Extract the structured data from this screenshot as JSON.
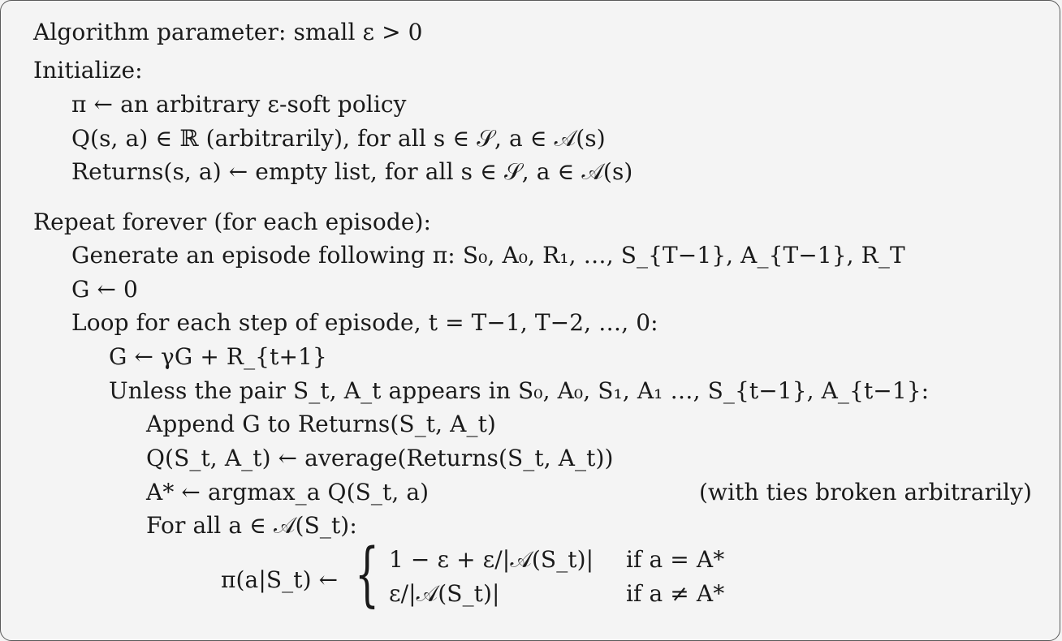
{
  "algorithm": {
    "param": "Algorithm parameter: small ε > 0",
    "init_header": "Initialize:",
    "init_pi": "π ← an arbitrary ε-soft policy",
    "init_q": "Q(s, a) ∈ ℝ (arbitrarily), for all s ∈ 𝒮, a ∈ 𝒜(s)",
    "init_returns": "Returns(s, a) ← empty list, for all s ∈ 𝒮, a ∈ 𝒜(s)",
    "repeat": "Repeat forever (for each episode):",
    "generate": "Generate an episode following π: S₀, A₀, R₁, …, S_{T−1}, A_{T−1}, R_T",
    "g_init": "G ← 0",
    "loop": "Loop for each step of episode, t = T−1, T−2, …, 0:",
    "g_update": "G ← γG + R_{t+1}",
    "unless": "Unless the pair S_t, A_t appears in S₀, A₀, S₁, A₁ …, S_{t−1}, A_{t−1}:",
    "append": "Append G to Returns(S_t, A_t)",
    "q_update": "Q(S_t, A_t) ← average(Returns(S_t, A_t))",
    "a_star": "A* ← argmax_a Q(S_t, a)",
    "ties_note": "(with ties broken arbitrarily)",
    "for_all": "For all a ∈ 𝒜(S_t):",
    "pi_lhs": "π(a|S_t) ←",
    "case1_value": "1 − ε + ε/|𝒜(S_t)|",
    "case1_cond": "if a = A*",
    "case2_value": "ε/|𝒜(S_t)|",
    "case2_cond": "if a ≠ A*"
  }
}
